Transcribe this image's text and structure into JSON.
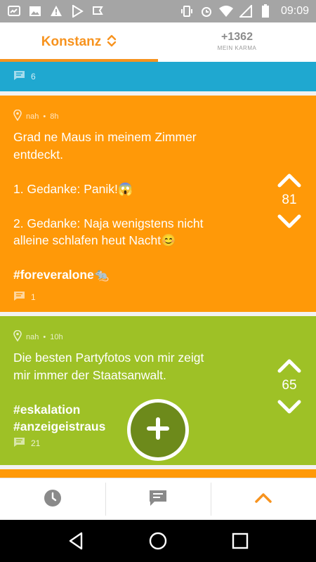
{
  "status_bar": {
    "time": "09:09",
    "left_icons": [
      "cast-icon",
      "image-icon",
      "warning-icon",
      "play-store-icon",
      "flag-icon"
    ],
    "right_icons": [
      "vibrate-icon",
      "alarm-icon",
      "wifi-icon",
      "signal-icon",
      "battery-icon"
    ]
  },
  "header": {
    "location": "Konstanz",
    "karma_value": "+1362",
    "karma_label": "MEIN KARMA",
    "accent": "#f7931e"
  },
  "posts": [
    {
      "color": "#1fa8d0",
      "comment_count": "6"
    },
    {
      "color": "#ff9908",
      "distance": "nah",
      "age": "8h",
      "lines": [
        "Grad ne Maus in meinem Zimmer",
        "entdeckt.",
        "",
        "1. Gedanke: Panik!😱",
        "",
        "2. Gedanke: Naja wenigstens nicht",
        "alleine schlafen heut Nacht😊",
        ""
      ],
      "hashtags": [
        "#foreveralone🐀"
      ],
      "votes": "81",
      "comment_count": "1"
    },
    {
      "color": "#9ec126",
      "distance": "nah",
      "age": "10h",
      "lines": [
        "Die besten Partyfotos von mir zeigt",
        "mir immer der Staatsanwalt.",
        ""
      ],
      "hashtags": [
        "#eskalation",
        "#anzeigeistraus"
      ],
      "votes": "65",
      "comment_count": "21"
    }
  ],
  "tabbar": {
    "items": [
      "clock-icon",
      "chat-icon",
      "chevron-up-icon"
    ],
    "active_color": "#f7931e"
  },
  "nav": [
    "back-icon",
    "home-icon",
    "recents-icon"
  ]
}
